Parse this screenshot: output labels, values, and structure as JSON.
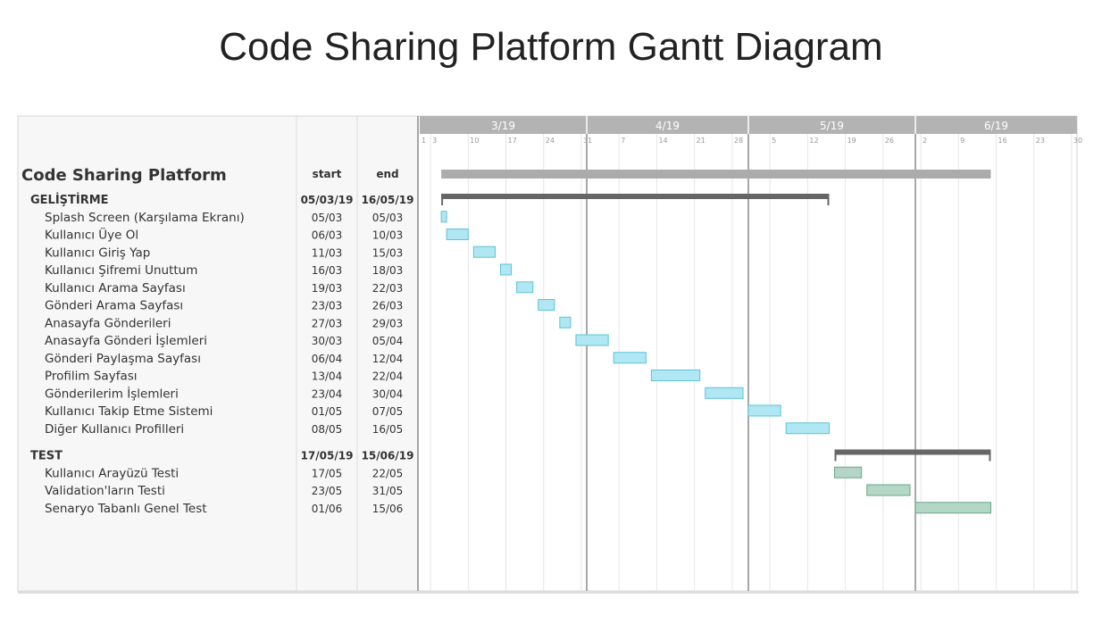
{
  "title": "Code Sharing Platform Gantt Diagram",
  "chart_data": {
    "type": "gantt",
    "year": 2019,
    "columns": {
      "start": "start",
      "end": "end"
    },
    "project": {
      "name": "Code Sharing Platform",
      "start": "2019-03-05",
      "end": "2019-06-15"
    },
    "months": [
      {
        "label": "3/19",
        "start": "2019-03-01"
      },
      {
        "label": "4/19",
        "start": "2019-04-01"
      },
      {
        "label": "5/19",
        "start": "2019-05-01"
      },
      {
        "label": "6/19",
        "start": "2019-06-01"
      }
    ],
    "ticks": [
      {
        "label": "1",
        "date": "2019-03-01"
      },
      {
        "label": "3",
        "date": "2019-03-03"
      },
      {
        "label": "10",
        "date": "2019-03-10"
      },
      {
        "label": "17",
        "date": "2019-03-17"
      },
      {
        "label": "24",
        "date": "2019-03-24"
      },
      {
        "label": "31",
        "date": "2019-03-31"
      },
      {
        "label": "7",
        "date": "2019-04-07"
      },
      {
        "label": "14",
        "date": "2019-04-14"
      },
      {
        "label": "21",
        "date": "2019-04-21"
      },
      {
        "label": "28",
        "date": "2019-04-28"
      },
      {
        "label": "5",
        "date": "2019-05-05"
      },
      {
        "label": "12",
        "date": "2019-05-12"
      },
      {
        "label": "19",
        "date": "2019-05-19"
      },
      {
        "label": "26",
        "date": "2019-05-26"
      },
      {
        "label": "2",
        "date": "2019-06-02"
      },
      {
        "label": "9",
        "date": "2019-06-09"
      },
      {
        "label": "16",
        "date": "2019-06-16"
      },
      {
        "label": "23",
        "date": "2019-06-23"
      },
      {
        "label": "30",
        "date": "2019-06-30"
      }
    ],
    "groups": [
      {
        "name": "GELİŞTİRME",
        "start_label": "05/03/19",
        "end_label": "16/05/19",
        "start": "2019-03-05",
        "end": "2019-05-16",
        "color": "#b0e7f2",
        "border": "#5cc3d8",
        "tasks": [
          {
            "name": "Splash Screen (Karşılama Ekranı)",
            "start_label": "05/03",
            "end_label": "05/03",
            "start": "2019-03-05",
            "end": "2019-03-05"
          },
          {
            "name": "Kullanıcı Üye Ol",
            "start_label": "06/03",
            "end_label": "10/03",
            "start": "2019-03-06",
            "end": "2019-03-10"
          },
          {
            "name": "Kullanıcı Giriş Yap",
            "start_label": "11/03",
            "end_label": "15/03",
            "start": "2019-03-11",
            "end": "2019-03-15"
          },
          {
            "name": "Kullanıcı Şifremi Unuttum",
            "start_label": "16/03",
            "end_label": "18/03",
            "start": "2019-03-16",
            "end": "2019-03-18"
          },
          {
            "name": "Kullanıcı Arama Sayfası",
            "start_label": "19/03",
            "end_label": "22/03",
            "start": "2019-03-19",
            "end": "2019-03-22"
          },
          {
            "name": "Gönderi Arama Sayfası",
            "start_label": "23/03",
            "end_label": "26/03",
            "start": "2019-03-23",
            "end": "2019-03-26"
          },
          {
            "name": "Anasayfa Gönderileri",
            "start_label": "27/03",
            "end_label": "29/03",
            "start": "2019-03-27",
            "end": "2019-03-29"
          },
          {
            "name": "Anasayfa Gönderi İşlemleri",
            "start_label": "30/03",
            "end_label": "05/04",
            "start": "2019-03-30",
            "end": "2019-04-05"
          },
          {
            "name": "Gönderi Paylaşma Sayfası",
            "start_label": "06/04",
            "end_label": "12/04",
            "start": "2019-04-06",
            "end": "2019-04-12"
          },
          {
            "name": "Profilim Sayfası",
            "start_label": "13/04",
            "end_label": "22/04",
            "start": "2019-04-13",
            "end": "2019-04-22"
          },
          {
            "name": "Gönderilerim İşlemleri",
            "start_label": "23/04",
            "end_label": "30/04",
            "start": "2019-04-23",
            "end": "2019-04-30"
          },
          {
            "name": "Kullanıcı Takip Etme Sistemi",
            "start_label": "01/05",
            "end_label": "07/05",
            "start": "2019-05-01",
            "end": "2019-05-07"
          },
          {
            "name": "Diğer Kullanıcı Profilleri",
            "start_label": "08/05",
            "end_label": "16/05",
            "start": "2019-05-08",
            "end": "2019-05-16"
          }
        ]
      },
      {
        "name": "TEST",
        "start_label": "17/05/19",
        "end_label": "15/06/19",
        "start": "2019-05-17",
        "end": "2019-06-15",
        "color": "#b3d6c6",
        "border": "#6aa58a",
        "tasks": [
          {
            "name": "Kullanıcı Arayüzü Testi",
            "start_label": "17/05",
            "end_label": "22/05",
            "start": "2019-05-17",
            "end": "2019-05-22"
          },
          {
            "name": "Validation'ların Testi",
            "start_label": "23/05",
            "end_label": "31/05",
            "start": "2019-05-23",
            "end": "2019-05-31"
          },
          {
            "name": "Senaryo Tabanlı Genel Test",
            "start_label": "01/06",
            "end_label": "15/06",
            "start": "2019-06-01",
            "end": "2019-06-15"
          }
        ]
      }
    ]
  }
}
